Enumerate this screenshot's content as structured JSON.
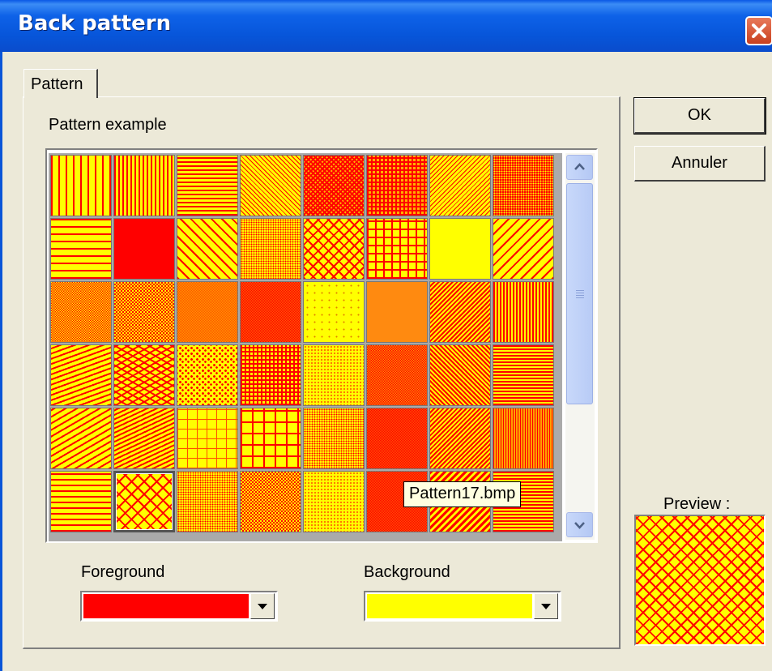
{
  "window": {
    "title": "Back pattern"
  },
  "tabs": [
    {
      "label": "Pattern"
    }
  ],
  "labels": {
    "pattern_example": "Pattern example",
    "foreground": "Foreground",
    "background": "Background",
    "preview": "Preview :"
  },
  "buttons": {
    "ok": "OK",
    "cancel": "Annuler"
  },
  "tooltip": "Pattern17.bmp",
  "colors": {
    "foreground": "#ff0000",
    "background": "#ffff00",
    "titlebar": "#0a5ce8",
    "dialog": "#ece9d8"
  },
  "patterns": [
    "vlines-wide",
    "vlines-mid",
    "hlines",
    "diag-right",
    "diag-cross-dense",
    "grid-dense",
    "diag-left",
    "dots-red",
    "hlines-wide",
    "solid-red",
    "diag-right-wide",
    "dots-fine",
    "diag-cross",
    "grid-wide",
    "solid-yellow",
    "diag-left-wide",
    "check-fine",
    "check-mid",
    "orange-fine",
    "red-fine",
    "dots-sparse",
    "orange-mid",
    "diag-left-fine",
    "vlines-fine",
    "wave-left",
    "zigzag",
    "confetti",
    "grid-mid",
    "dots-yellow",
    "check-red",
    "diag-right-fine",
    "hlines-fine",
    "dashed-diag",
    "wave-dense",
    "grid-dotted",
    "grid-large",
    "dots-fine",
    "red-dense",
    "diag-left-fine",
    "vlines-dense",
    "dashed-h",
    "brick-diag",
    "dots-fine",
    "check-mid",
    "dots-yellow",
    "red-dense",
    "stripes-mixed",
    "hlines-fine"
  ],
  "selected_pattern_index": 41,
  "scroll_icons": {
    "up": "chevron-up-icon",
    "down": "chevron-down-icon"
  }
}
